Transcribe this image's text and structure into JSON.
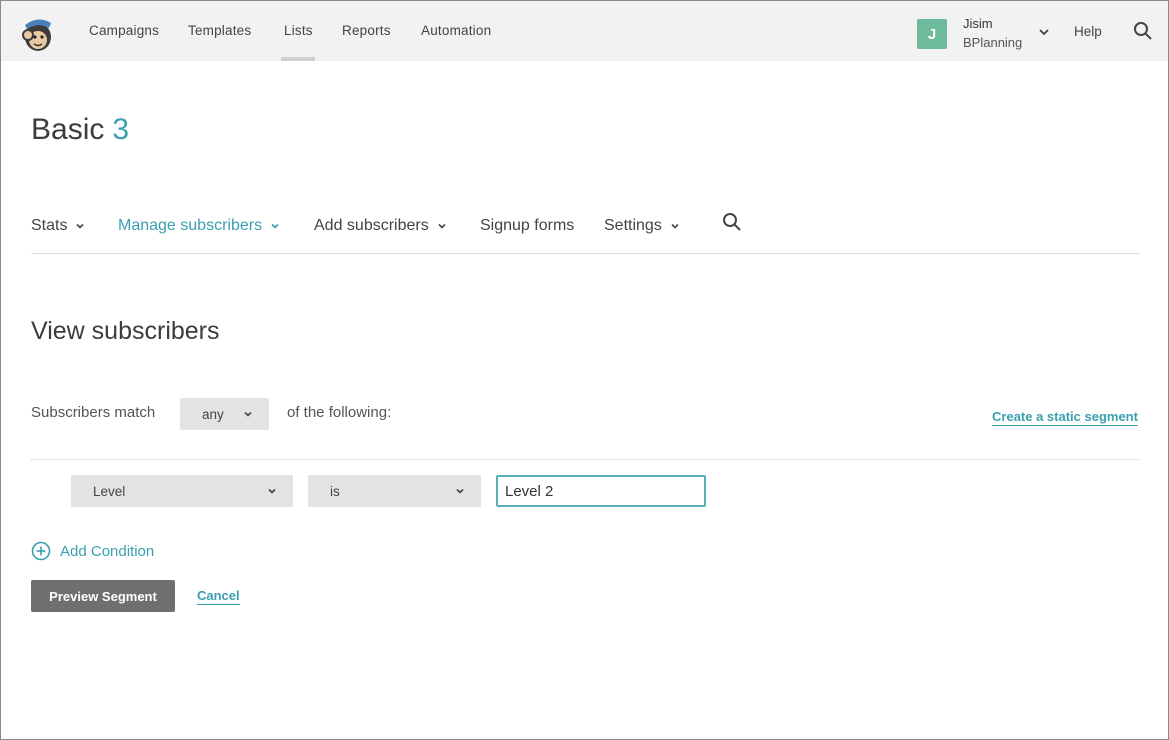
{
  "topnav": {
    "items": [
      {
        "label": "Campaigns"
      },
      {
        "label": "Templates"
      },
      {
        "label": "Lists"
      },
      {
        "label": "Reports"
      },
      {
        "label": "Automation"
      }
    ],
    "active": "Lists",
    "account": {
      "initial": "J",
      "name": "Jisim",
      "org": "BPlanning"
    },
    "help": "Help"
  },
  "page": {
    "title": "Basic",
    "count": "3"
  },
  "subnav": {
    "stats": "Stats",
    "manage": "Manage subscribers",
    "add": "Add subscribers",
    "signup": "Signup forms",
    "settings": "Settings"
  },
  "section": {
    "title": "View subscribers"
  },
  "segment": {
    "match_label": "Subscribers match",
    "match_value": "any",
    "match_tail": "of the following:",
    "static_link": "Create a static segment",
    "condition": {
      "field": "Level",
      "operator": "is",
      "value": "Level 2"
    },
    "add_condition": "Add Condition",
    "preview_button": "Preview Segment",
    "cancel": "Cancel"
  },
  "colors": {
    "accent": "#3a9fb0",
    "avatar": "#6dbb9c",
    "topbar": "#f2f2f2"
  }
}
